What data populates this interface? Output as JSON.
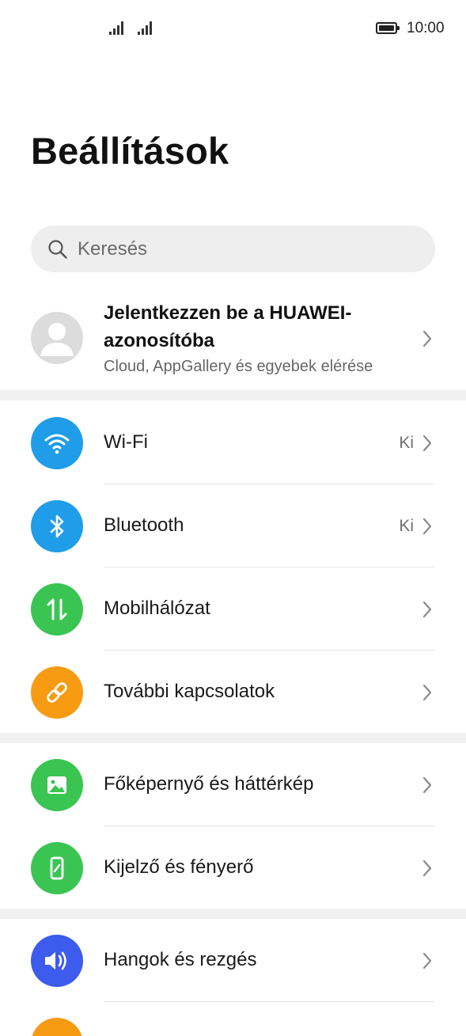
{
  "status_bar": {
    "time": "10:00"
  },
  "page": {
    "title": "Beállítások"
  },
  "search": {
    "placeholder": "Keresés"
  },
  "account": {
    "title": "Jelentkezzen be a HUAWEI-azonosítóba",
    "subtitle": "Cloud, AppGallery és egyebek elérése"
  },
  "colors": {
    "blue": "#1f9de8",
    "green": "#3ac552",
    "orange": "#f79b12",
    "indigo": "#3d5bec"
  },
  "sections": [
    {
      "items": [
        {
          "label": "Wi-Fi",
          "value": "Ki",
          "icon": "wifi-icon"
        },
        {
          "label": "Bluetooth",
          "value": "Ki",
          "icon": "bluetooth-icon"
        },
        {
          "label": "Mobilhálózat",
          "icon": "mobile-data-icon"
        },
        {
          "label": "További kapcsolatok",
          "icon": "link-icon"
        }
      ]
    },
    {
      "items": [
        {
          "label": "Főképernyő és háttérkép",
          "icon": "wallpaper-icon"
        },
        {
          "label": "Kijelző és fényerő",
          "icon": "display-icon"
        }
      ]
    },
    {
      "items": [
        {
          "label": "Hangok és rezgés",
          "icon": "sound-icon"
        }
      ]
    }
  ]
}
